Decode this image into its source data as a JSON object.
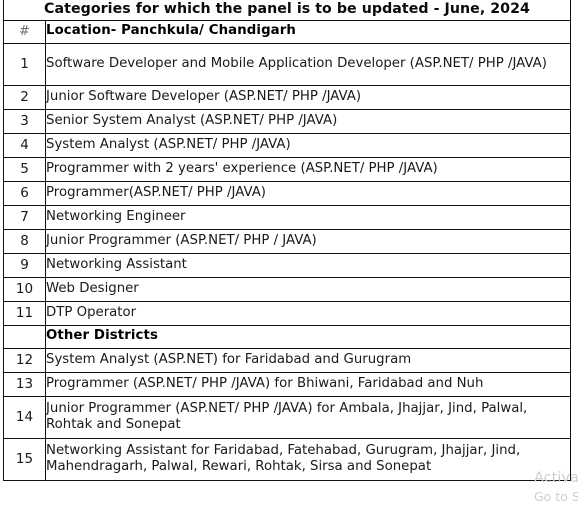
{
  "document": {
    "title": "Categories for which the panel is to be updated - June, 2024"
  },
  "table": {
    "headers": {
      "number": "#",
      "description": "Location- Panchkula/ Chandigarh"
    },
    "section_other": {
      "number": "",
      "description": "Other Districts"
    },
    "rows": [
      {
        "number": "1",
        "description": "Software Developer and Mobile Application Developer (ASP.NET/ PHP /JAVA)"
      },
      {
        "number": "2",
        "description": "Junior Software Developer (ASP.NET/ PHP /JAVA)"
      },
      {
        "number": "3",
        "description": "Senior System Analyst (ASP.NET/ PHP /JAVA)"
      },
      {
        "number": "4",
        "description": "System Analyst (ASP.NET/ PHP /JAVA)"
      },
      {
        "number": "5",
        "description": "Programmer with 2 years' experience (ASP.NET/ PHP /JAVA)"
      },
      {
        "number": "6",
        "description": "Programmer(ASP.NET/ PHP /JAVA)"
      },
      {
        "number": "7",
        "description": "Networking Engineer"
      },
      {
        "number": "8",
        "description": "Junior Programmer (ASP.NET/ PHP / JAVA)"
      },
      {
        "number": "9",
        "description": "Networking Assistant"
      },
      {
        "number": "10",
        "description": "Web Designer"
      },
      {
        "number": "11",
        "description": "DTP Operator"
      },
      {
        "number": "12",
        "description": "System Analyst  (ASP.NET) for Faridabad and Gurugram"
      },
      {
        "number": "13",
        "description": "Programmer  (ASP.NET/ PHP /JAVA) for Bhiwani, Faridabad and Nuh"
      },
      {
        "number": "14",
        "description": "Junior Programmer  (ASP.NET/ PHP /JAVA) for Ambala, Jhajjar, Jind, Palwal, Rohtak and Sonepat"
      },
      {
        "number": "15",
        "description": "Networking Assistant for Faridabad, Fatehabad, Gurugram, Jhajjar, Jind, Mahendragarh, Palwal, Rewari, Rohtak, Sirsa and Sonepat"
      }
    ]
  },
  "watermark": {
    "line1": "Activate Windows",
    "line2": "Go to Settings to activate Windows."
  },
  "colors": {
    "border": "#111111",
    "text": "#1a1a1a",
    "muted": "#6d6d6d",
    "watermark": "#cfcfcf",
    "background": "#ffffff"
  }
}
